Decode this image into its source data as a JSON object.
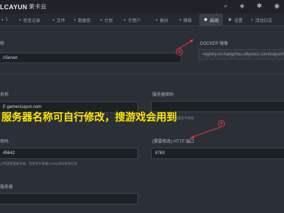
{
  "header": {
    "logo_brand": "LCAYUN",
    "logo_cn": "莱卡云",
    "icons": [
      "search-icon",
      "layers-icon",
      "settings-icon",
      "user-icon"
    ]
  },
  "tabs": [
    {
      "label": "1",
      "icon": "server-icon"
    },
    {
      "label": "状态记录",
      "icon": "log-icon"
    },
    {
      "label": "文件",
      "icon": "file-icon"
    },
    {
      "label": "数据库",
      "icon": "database-icon"
    },
    {
      "label": "计划",
      "icon": "clock-icon"
    },
    {
      "label": "子用户",
      "icon": "users-icon"
    },
    {
      "label": "备份",
      "icon": "backup-icon"
    },
    {
      "label": "网络",
      "icon": "network-icon"
    },
    {
      "label": "启动",
      "icon": "startup-icon",
      "active": true
    },
    {
      "label": "设置",
      "icon": "gear-icon"
    },
    {
      "label": "活动日志",
      "icon": "activity-icon"
    }
  ],
  "form": {
    "server_name_label": "称",
    "server_name_value": "cServer",
    "docker_label": "DOCKER 镜像",
    "docker_value": "registry.cn-hangzhou.aliyuncs.com/lcayun/St",
    "name_label": "名称",
    "name_value": "E gamecicayun.com",
    "password_label": "服务器密码",
    "password_hint": "非必须，当前密码留空不修改",
    "port_label": "(需要修改) HTTP 端口",
    "port_value": "8763",
    "steam_label": "密码",
    "steam_value": "45642",
    "steam_hint": "以用来管理服务器，若要求外部输入/help获取更多信息",
    "bottom_label": "服务器"
  },
  "annotation": {
    "text": "服务器名称可自行修改，搜游戏会用到",
    "marker1": "①",
    "marker2": "②"
  },
  "colors": {
    "annotation": "#ffe400",
    "marker": "#e23b3b",
    "background": "#2b2f36"
  }
}
